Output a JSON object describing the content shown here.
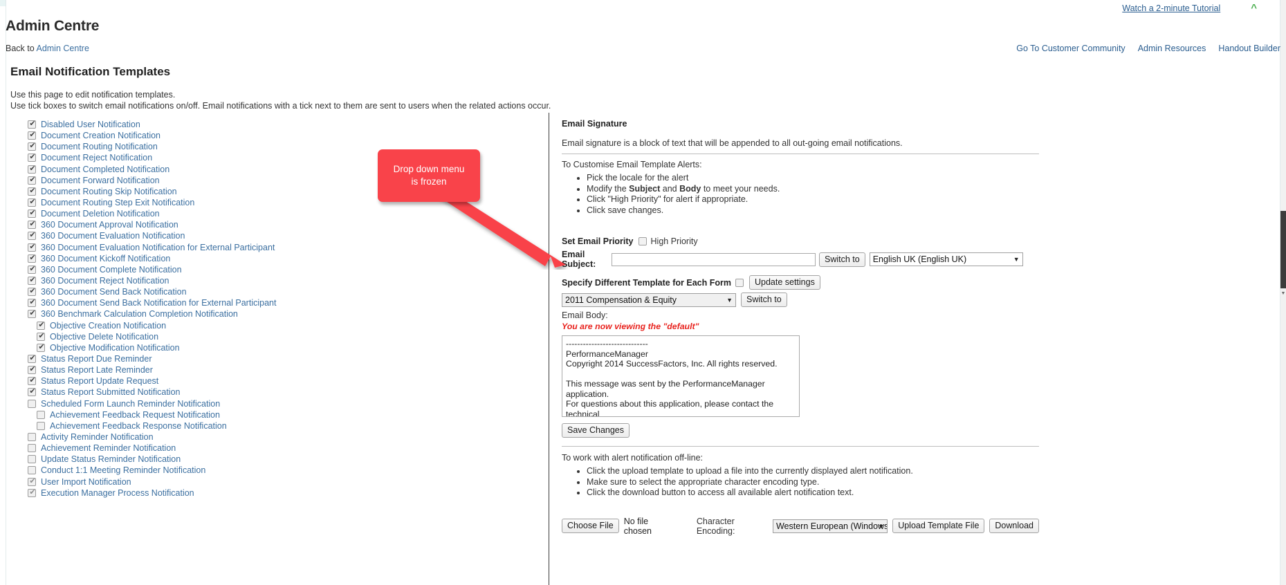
{
  "header": {
    "tutorial_link": "Watch a 2-minute Tutorial",
    "collapse_icon": "chevron-up-icon",
    "title": "Admin Centre",
    "back_prefix": "Back to",
    "back_link": "Admin Centre",
    "nav": [
      "Go To Customer Community",
      "Admin Resources",
      "Handout Builder"
    ]
  },
  "page": {
    "heading": "Email Notification Templates",
    "intro_line1": "Use this page to edit notification templates.",
    "intro_line2": "Use tick boxes to switch email notifications on/off. Email notifications with a tick next to them are sent to users when the related actions occur."
  },
  "notifications": [
    {
      "label": "Disabled User Notification",
      "checked": true,
      "indent": false,
      "dim": false
    },
    {
      "label": "Document Creation Notification",
      "checked": true,
      "indent": false,
      "dim": false
    },
    {
      "label": "Document Routing Notification",
      "checked": true,
      "indent": false,
      "dim": false
    },
    {
      "label": "Document Reject Notification",
      "checked": true,
      "indent": false,
      "dim": false
    },
    {
      "label": "Document Completed Notification",
      "checked": true,
      "indent": false,
      "dim": false
    },
    {
      "label": "Document Forward Notification",
      "checked": true,
      "indent": false,
      "dim": false
    },
    {
      "label": "Document Routing Skip Notification",
      "checked": true,
      "indent": false,
      "dim": false
    },
    {
      "label": "Document Routing Step Exit Notification",
      "checked": true,
      "indent": false,
      "dim": false
    },
    {
      "label": "Document Deletion Notification",
      "checked": true,
      "indent": false,
      "dim": false
    },
    {
      "label": "360 Document Approval Notification",
      "checked": true,
      "indent": false,
      "dim": false
    },
    {
      "label": "360 Document Evaluation Notification",
      "checked": true,
      "indent": false,
      "dim": false
    },
    {
      "label": "360 Document Evaluation Notification for External Participant",
      "checked": true,
      "indent": false,
      "dim": false
    },
    {
      "label": "360 Document Kickoff Notification",
      "checked": true,
      "indent": false,
      "dim": false
    },
    {
      "label": "360 Document Complete Notification",
      "checked": true,
      "indent": false,
      "dim": false
    },
    {
      "label": "360 Document Reject Notification",
      "checked": true,
      "indent": false,
      "dim": false
    },
    {
      "label": "360 Document Send Back Notification",
      "checked": true,
      "indent": false,
      "dim": false
    },
    {
      "label": "360 Document Send Back Notification for External Participant",
      "checked": true,
      "indent": false,
      "dim": false
    },
    {
      "label": "360 Benchmark Calculation Completion Notification",
      "checked": true,
      "indent": false,
      "dim": false
    },
    {
      "label": "Objective Creation Notification",
      "checked": true,
      "indent": true,
      "dim": false
    },
    {
      "label": "Objective Delete Notification",
      "checked": true,
      "indent": true,
      "dim": false
    },
    {
      "label": "Objective Modification Notification",
      "checked": true,
      "indent": true,
      "dim": false
    },
    {
      "label": "Status Report Due Reminder",
      "checked": true,
      "indent": false,
      "dim": false
    },
    {
      "label": "Status Report Late Reminder",
      "checked": true,
      "indent": false,
      "dim": false
    },
    {
      "label": "Status Report Update Request",
      "checked": true,
      "indent": false,
      "dim": false
    },
    {
      "label": "Status Report Submitted Notification",
      "checked": true,
      "indent": false,
      "dim": false
    },
    {
      "label": "Scheduled Form Launch Reminder Notification",
      "checked": false,
      "indent": false,
      "dim": false
    },
    {
      "label": "Achievement Feedback Request Notification",
      "checked": false,
      "indent": true,
      "dim": false
    },
    {
      "label": "Achievement Feedback Response Notification",
      "checked": false,
      "indent": true,
      "dim": false
    },
    {
      "label": "Activity Reminder Notification",
      "checked": false,
      "indent": false,
      "dim": false
    },
    {
      "label": "Achievement Reminder Notification",
      "checked": false,
      "indent": false,
      "dim": false
    },
    {
      "label": "Update Status Reminder Notification",
      "checked": false,
      "indent": false,
      "dim": false
    },
    {
      "label": "Conduct 1:1 Meeting Reminder Notification",
      "checked": false,
      "indent": false,
      "dim": false
    },
    {
      "label": "User Import Notification",
      "checked": true,
      "indent": false,
      "dim": true
    },
    {
      "label": "Execution Manager Process Notification",
      "checked": true,
      "indent": false,
      "dim": true
    }
  ],
  "signature": {
    "title": "Email Signature",
    "description": "Email signature is a block of text that will be appended to all out-going email notifications.",
    "customise_heading": "To Customise Email Template Alerts:",
    "bullets": [
      {
        "pre": "Pick the locale for the alert",
        "b1": "",
        "mid": "",
        "b2": "",
        "post": ""
      },
      {
        "pre": "Modify the ",
        "b1": "Subject",
        "mid": " and ",
        "b2": "Body",
        "post": " to meet your needs."
      },
      {
        "pre": "Click \"High Priority\" for alert if appropriate.",
        "b1": "",
        "mid": "",
        "b2": "",
        "post": ""
      },
      {
        "pre": "Click save changes.",
        "b1": "",
        "mid": "",
        "b2": "",
        "post": ""
      }
    ]
  },
  "form": {
    "priority_label": "Set Email Priority",
    "priority_checkbox_label": "High Priority",
    "priority_checked": false,
    "subject_label": "Email Subject:",
    "subject_value": "",
    "subject_placeholder": "",
    "switch_to_locale_button": "Switch to",
    "locale_selected": "English UK (English UK)",
    "per_form_label": "Specify Different Template for Each Form",
    "per_form_checked": false,
    "update_settings_button": "Update settings",
    "form_selected": "2011 Compensation & Equity",
    "switch_to_form_button": "Switch to",
    "body_label": "Email Body:",
    "viewing_warning": "You are now viewing the \"default\"",
    "body_value": "-----------------------------\nPerformanceManager\nCopyright 2014 SuccessFactors, Inc. All rights reserved.\n\nThis message was sent by the PerformanceManager application.\nFor questions about this application, please contact the technical\nsupport personnel.",
    "save_changes_button": "Save Changes"
  },
  "offline": {
    "heading": "To work with alert notification off-line:",
    "bullets": [
      "Click the upload template to upload a file into the currently displayed alert notification.",
      "Make sure to select the appropriate character encoding type.",
      "Click the download button to access all available alert notification text."
    ],
    "choose_file_button": "Choose File",
    "no_file_text": "No file chosen",
    "encoding_label": "Character Encoding:",
    "encoding_selected": "Western European (Windows/ISO)",
    "upload_button": "Upload Template File",
    "download_button": "Download"
  },
  "callout": {
    "line1": "Drop down menu",
    "line2": "is frozen",
    "color": "#f9434a"
  },
  "colors": {
    "link": "#3b6fa0",
    "nav_link": "#2a5d8f",
    "warning_red": "#e8231e",
    "chevron_green": "#4caf50",
    "top_strip": "#e8f4f4"
  }
}
